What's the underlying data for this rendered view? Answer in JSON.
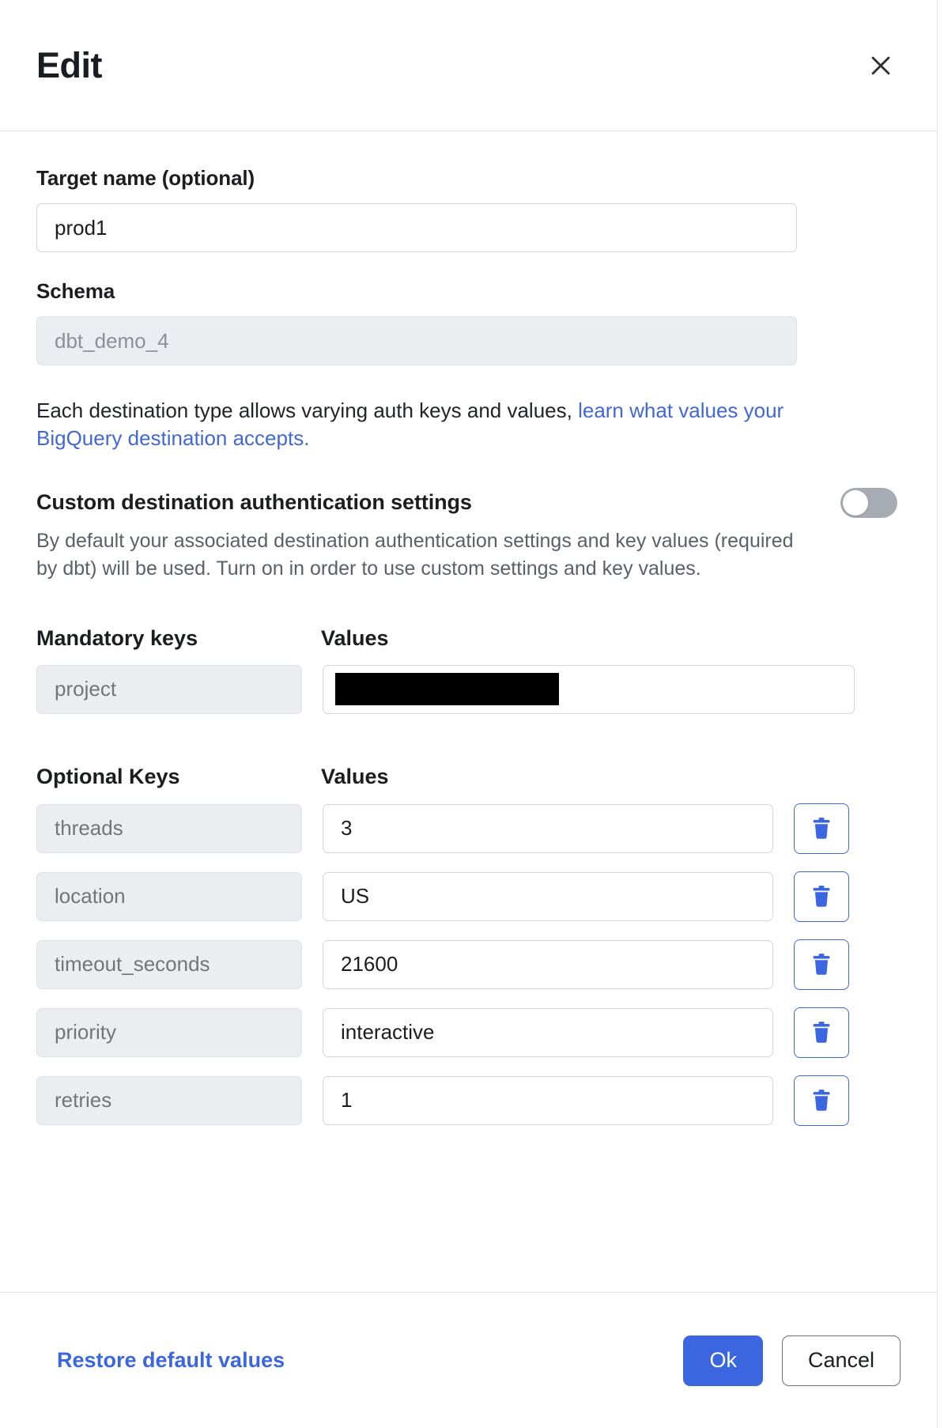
{
  "dialog": {
    "title": "Edit",
    "close_icon": "close-icon"
  },
  "form": {
    "target_name": {
      "label": "Target name (optional)",
      "value": "prod1",
      "placeholder": ""
    },
    "schema": {
      "label": "Schema",
      "value": "",
      "placeholder": "dbt_demo_4",
      "disabled": true
    },
    "help": {
      "text_before": "Each destination type allows varying auth keys and values, ",
      "link_text": "learn what values your BigQuery destination accepts."
    },
    "custom_auth": {
      "title": "Custom destination authentication settings",
      "description": "By default your associated destination authentication settings and key values (required by dbt) will be used. Turn on in order to use custom settings and key values.",
      "toggle_state": "off"
    },
    "mandatory": {
      "keys_header": "Mandatory keys",
      "values_header": "Values",
      "rows": [
        {
          "key": "project",
          "value": "",
          "redacted": true
        }
      ]
    },
    "optional": {
      "keys_header": "Optional Keys",
      "values_header": "Values",
      "delete_icon": "trash-icon",
      "rows": [
        {
          "key": "threads",
          "value": "3"
        },
        {
          "key": "location",
          "value": "US"
        },
        {
          "key": "timeout_seconds",
          "value": "21600"
        },
        {
          "key": "priority",
          "value": "interactive"
        },
        {
          "key": "retries",
          "value": "1"
        }
      ]
    }
  },
  "footer": {
    "restore_label": "Restore default values",
    "ok_label": "Ok",
    "cancel_label": "Cancel"
  },
  "colors": {
    "accent_blue": "#3b66e0",
    "link_blue": "#4267d6",
    "toggle_off": "#a7abb4",
    "disabled_bg": "#ebedf1"
  }
}
